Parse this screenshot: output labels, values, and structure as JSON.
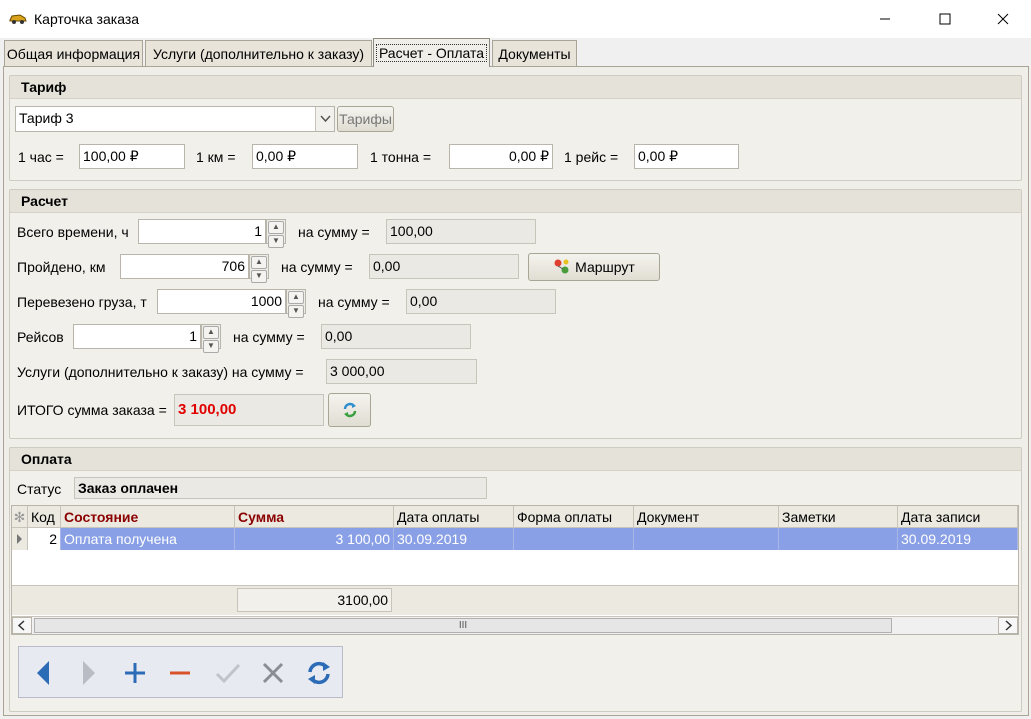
{
  "window": {
    "title": "Карточка заказа",
    "controls": [
      "minimize-icon",
      "maximize-icon",
      "close-icon"
    ]
  },
  "tabs": [
    {
      "label": "Общая информация"
    },
    {
      "label": "Услуги (дополнительно к заказу)"
    },
    {
      "label": "Расчет - Оплата",
      "active": true
    },
    {
      "label": "Документы"
    }
  ],
  "tariff": {
    "heading": "Тариф",
    "selected": "Тариф 3",
    "tariffs_button": "Тарифы",
    "rates": [
      {
        "label": "1 час =",
        "value": "100,00 ₽"
      },
      {
        "label": "1 км =",
        "value": "0,00 ₽"
      },
      {
        "label": "1 тонна =",
        "value": "0,00 ₽"
      },
      {
        "label": "1 рейс =",
        "value": "0,00 ₽"
      }
    ]
  },
  "calc": {
    "heading": "Расчет",
    "rows": [
      {
        "label": "Всего времени, ч",
        "value": "1",
        "sum_label": "на сумму =",
        "sum": "100,00"
      },
      {
        "label": "Пройдено, км",
        "value": "706",
        "sum_label": "на сумму =",
        "sum": "0,00"
      },
      {
        "label": "Перевезено груза, т",
        "value": "1000",
        "sum_label": "на сумму =",
        "sum": "0,00"
      },
      {
        "label": "Рейсов",
        "value": "1",
        "sum_label": "на сумму =",
        "sum": "0,00"
      }
    ],
    "route_button": "Маршрут",
    "services_label": "Услуги (дополнительно к заказу) на сумму =",
    "services_sum": "3 000,00",
    "total_label": "ИТОГО сумма заказа =",
    "total_value": "3 100,00",
    "colors": {
      "total": "#e00000"
    }
  },
  "payment": {
    "heading": "Оплата",
    "status_label": "Статус",
    "status_value": "Заказ оплачен",
    "columns": [
      "Код",
      "Состояние",
      "Сумма",
      "Дата оплаты",
      "Форма оплаты",
      "Документ",
      "Заметки",
      "Дата записи"
    ],
    "rows": [
      {
        "code": "2",
        "state": "Оплата получена",
        "sum": "3 100,00",
        "pay_date": "30.09.2019",
        "form": "",
        "doc": "",
        "notes": "",
        "rec_date": "30.09.2019"
      }
    ],
    "footer_sum": "3100,00",
    "scroll_grip": "III",
    "nav_buttons": [
      "prev-icon",
      "next-icon",
      "add-icon",
      "delete-icon",
      "confirm-icon",
      "cancel-icon",
      "refresh-icon"
    ],
    "colors": {
      "selected_row": "#8aa0e6",
      "header_accent": "#8b0000"
    }
  }
}
